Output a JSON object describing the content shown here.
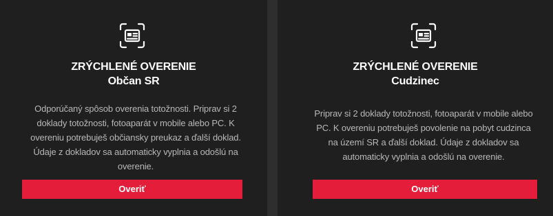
{
  "cards": [
    {
      "icon": "id-card-scan-icon",
      "title_line1": "ZRÝCHLENÉ OVERENIE",
      "title_line2": "Občan SR",
      "description": "Odporúčaný spôsob overenia totožnosti. Priprav si 2 doklady totožnosti, fotoaparát v mobile alebo PC. K overeniu potrebuješ občiansky preukaz a ďalší doklad. Údaje z dokladov sa automaticky vyplnia a odošlú na overenie.",
      "button_label": "Overiť"
    },
    {
      "icon": "id-card-scan-icon",
      "title_line1": "ZRÝCHLENÉ OVERENIE",
      "title_line2": "Cudzinec",
      "description": "Priprav si 2 doklady totožnosti, fotoaparát v mobile alebo PC. K overeniu potrebuješ povolenie na pobyt cudzinca na území SR a ďalší doklad. Údaje z dokladov sa automaticky vyplnia a odošlú na overenie.",
      "button_label": "Overiť"
    }
  ],
  "colors": {
    "page_bg": "#2e2e2e",
    "card_bg": "#1f1f1f",
    "text_primary": "#ffffff",
    "text_secondary": "#b8b8b8",
    "accent": "#e31d3a"
  }
}
